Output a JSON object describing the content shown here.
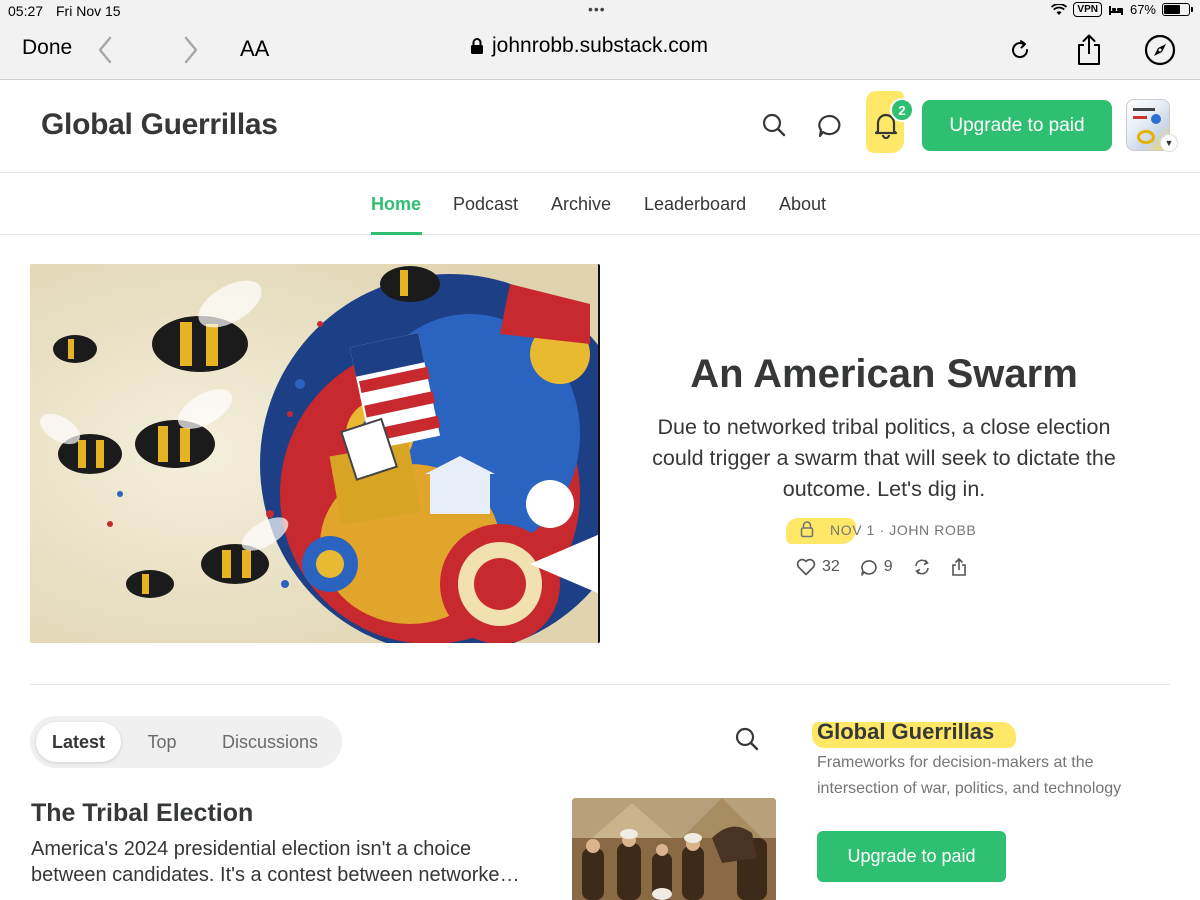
{
  "status_bar": {
    "time": "05:27",
    "date": "Fri Nov 15",
    "vpn": "VPN",
    "battery": "67%",
    "battery_level": 0.67
  },
  "browser": {
    "done_label": "Done",
    "text_size_label": "AA",
    "url": "johnrobb.substack.com"
  },
  "site": {
    "title": "Global Guerrillas",
    "notification_count": "2",
    "upgrade_label": "Upgrade to paid"
  },
  "nav": {
    "items": [
      {
        "label": "Home",
        "active": true
      },
      {
        "label": "Podcast"
      },
      {
        "label": "Archive"
      },
      {
        "label": "Leaderboard"
      },
      {
        "label": "About"
      }
    ]
  },
  "featured": {
    "title": "An American Swarm",
    "subtitle": "Due to networked tribal politics, a close election could trigger a swarm that will seek to dictate the outcome. Let's dig in.",
    "meta": "NOV 1 · JOHN ROBB",
    "likes": "32",
    "comments": "9"
  },
  "feed": {
    "tabs": [
      "Latest",
      "Top",
      "Discussions"
    ],
    "active_tab": "Latest",
    "post": {
      "title": "The Tribal Election",
      "desc_line1": "America's 2024 presidential election isn't a choice",
      "desc_line2": "between candidates. It's a contest between networked..."
    }
  },
  "sidebar": {
    "title": "Global Guerrillas",
    "description": "Frameworks for decision-makers at the intersection of war, politics, and technology",
    "upgrade_label": "Upgrade to paid"
  },
  "colors": {
    "accent": "#2fbf71",
    "text": "#363737",
    "highlight": "#ffe44d"
  }
}
